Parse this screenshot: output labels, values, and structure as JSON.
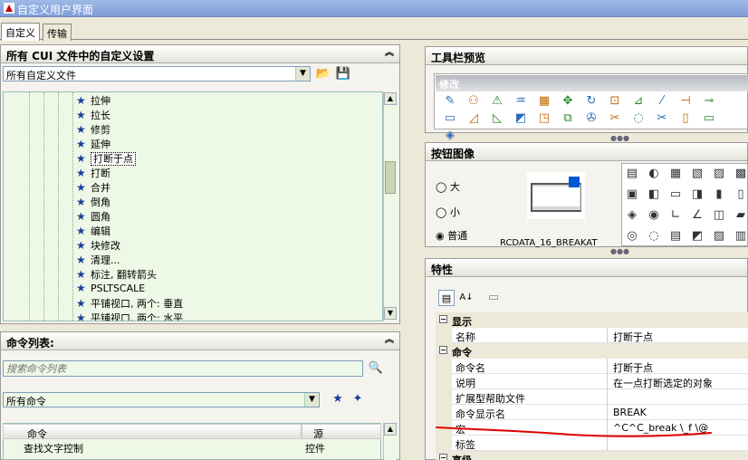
{
  "window": {
    "title": "自定义用户界面"
  },
  "tabs": [
    {
      "label": "自定义"
    },
    {
      "label": "传输"
    }
  ],
  "cui_panel": {
    "header": "所有 CUI 文件中的自定义设置",
    "file_combo": "所有自定义文件",
    "tree_items": [
      {
        "label": "拉伸"
      },
      {
        "label": "拉长"
      },
      {
        "label": "修剪"
      },
      {
        "label": "延伸"
      },
      {
        "label": "打断于点",
        "selected": true
      },
      {
        "label": "打断"
      },
      {
        "label": "合并"
      },
      {
        "label": "倒角"
      },
      {
        "label": "圆角"
      },
      {
        "label": "编辑"
      },
      {
        "label": "块修改"
      },
      {
        "label": "清理..."
      },
      {
        "label": "标注, 翻转箭头"
      },
      {
        "label": "PSLTSCALE"
      },
      {
        "label": "平铺视口, 两个:   垂直"
      },
      {
        "label": "平铺视口, 两个:   水平"
      }
    ]
  },
  "command_list": {
    "header": "命令列表:",
    "search_placeholder": "搜索命令列表",
    "filter_combo": "所有命令",
    "columns": {
      "command": "命令",
      "source": "源"
    },
    "rows": [
      {
        "command": "查找文字控制",
        "source": "控件"
      }
    ]
  },
  "toolbar_preview": {
    "header": "工具栏预览",
    "toolbar_name": "修改"
  },
  "button_image": {
    "header": "按钮图像",
    "radios": [
      {
        "label": "大"
      },
      {
        "label": "小"
      },
      {
        "label": "普通",
        "checked": true
      }
    ],
    "resource_name": "RCDATA_16_BREAKAT"
  },
  "properties": {
    "header": "特性",
    "categories": [
      {
        "label": "显示",
        "rows": [
          {
            "name": "名称",
            "value": "打断于点"
          }
        ]
      },
      {
        "label": "命令",
        "rows": [
          {
            "name": "命令名",
            "value": "打断于点"
          },
          {
            "name": "说明",
            "value": "在一点打断选定的对象"
          },
          {
            "name": "扩展型帮助文件",
            "value": ""
          },
          {
            "name": "命令显示名",
            "value": "BREAK"
          },
          {
            "name": "宏",
            "value": "^C^C_break \\_f \\@"
          },
          {
            "name": "标签",
            "value": ""
          }
        ]
      },
      {
        "label": "高级",
        "rows": []
      }
    ]
  },
  "colors": {
    "annotation_line": "#e00000",
    "tree_bg": "#eef8e6",
    "star_icon": "#1a3d9c"
  }
}
